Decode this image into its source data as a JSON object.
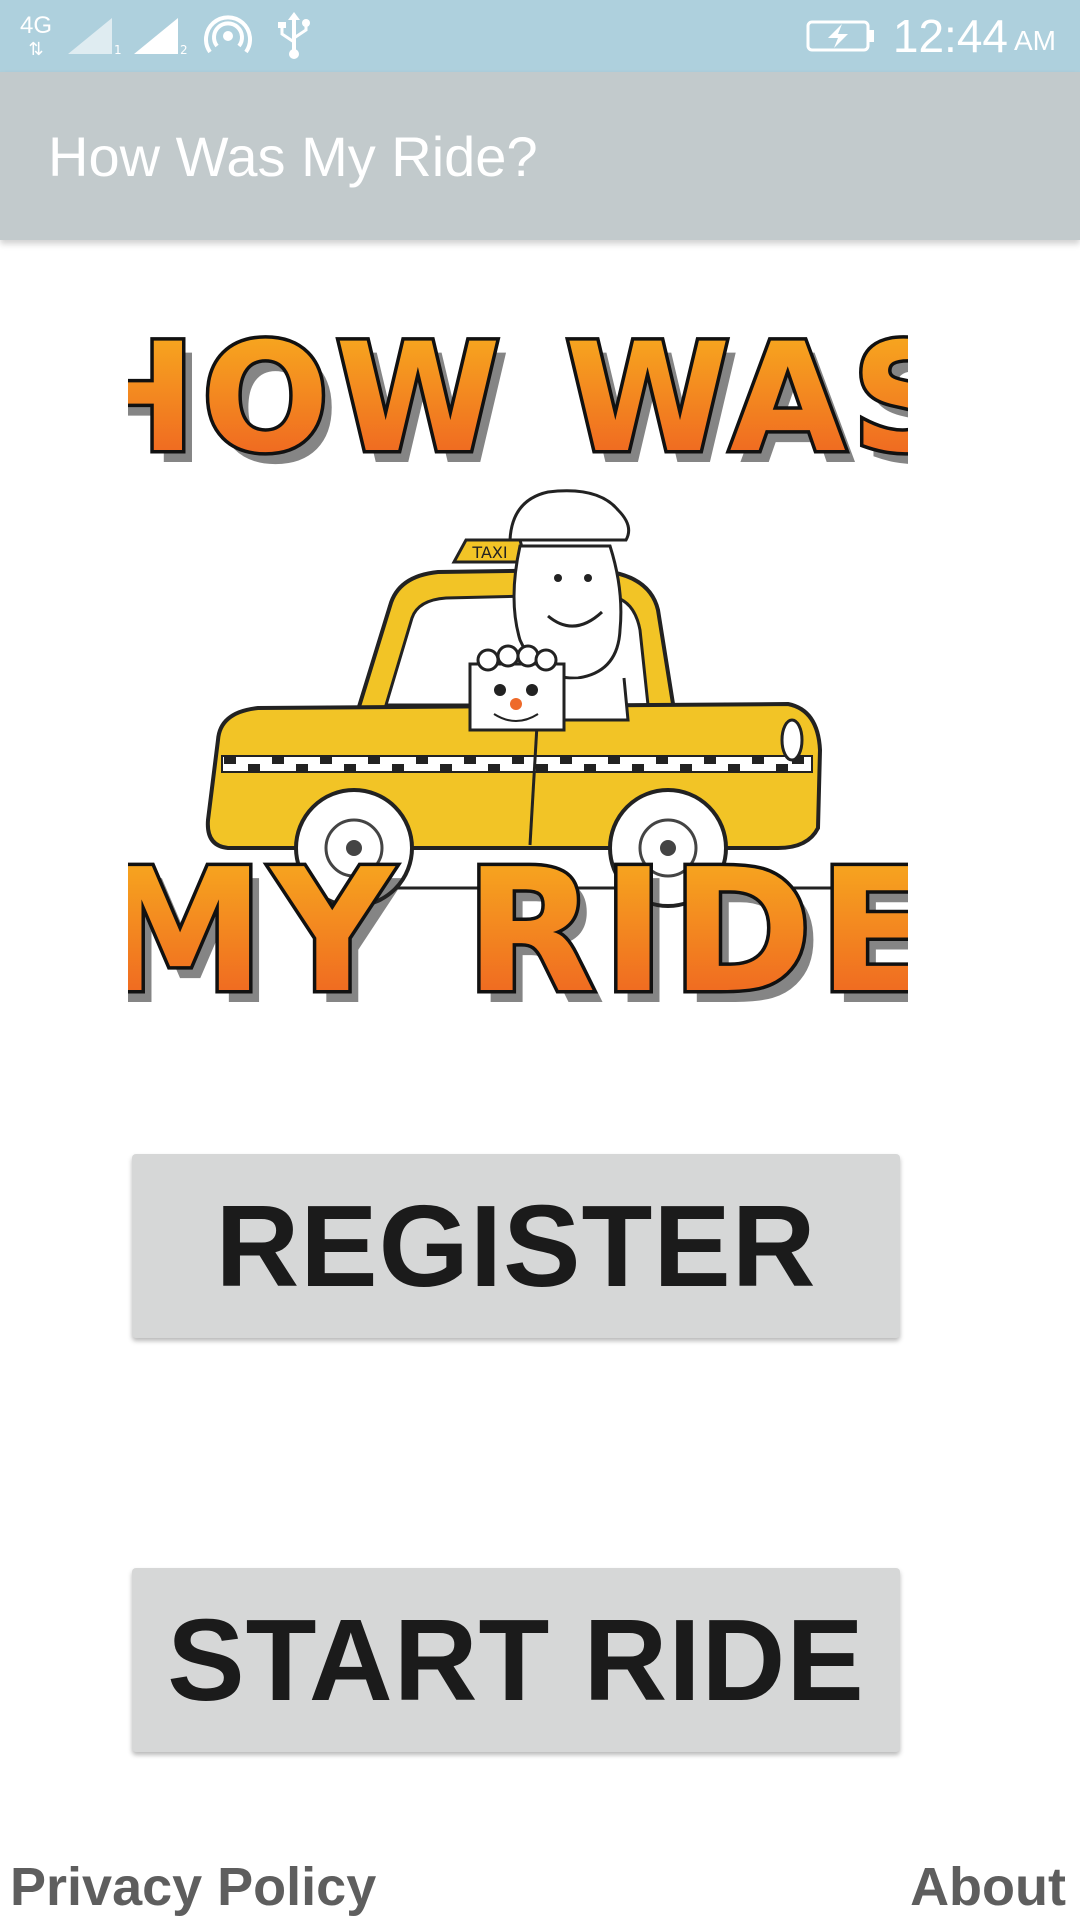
{
  "status_bar": {
    "network_label": "4G",
    "sim1_label": "1",
    "sim2_label": "2",
    "time": "12:44",
    "ampm": "AM",
    "icons": [
      "network-4g-icon",
      "signal-sim1-icon",
      "signal-sim2-icon",
      "hotspot-icon",
      "usb-icon",
      "battery-charging-icon"
    ]
  },
  "app_bar": {
    "title": "How Was My Ride?"
  },
  "logo": {
    "top_text": "HOW WAS",
    "bottom_text": "MY RIDE",
    "sign_text": "TAXI",
    "colors": {
      "gradient_top": "#f8b21e",
      "gradient_bottom": "#ee5a22",
      "taxi_yellow": "#f2c426"
    }
  },
  "buttons": {
    "register": "REGISTER",
    "start_ride": "START RIDE"
  },
  "footer": {
    "privacy": "Privacy Policy",
    "about": "About"
  },
  "colors": {
    "status_bar": "#aed0dd",
    "app_bar": "#c2cacc",
    "button_bg": "#d6d7d7",
    "button_text": "#1b1b1b",
    "footer_text": "#5e5e5e"
  }
}
